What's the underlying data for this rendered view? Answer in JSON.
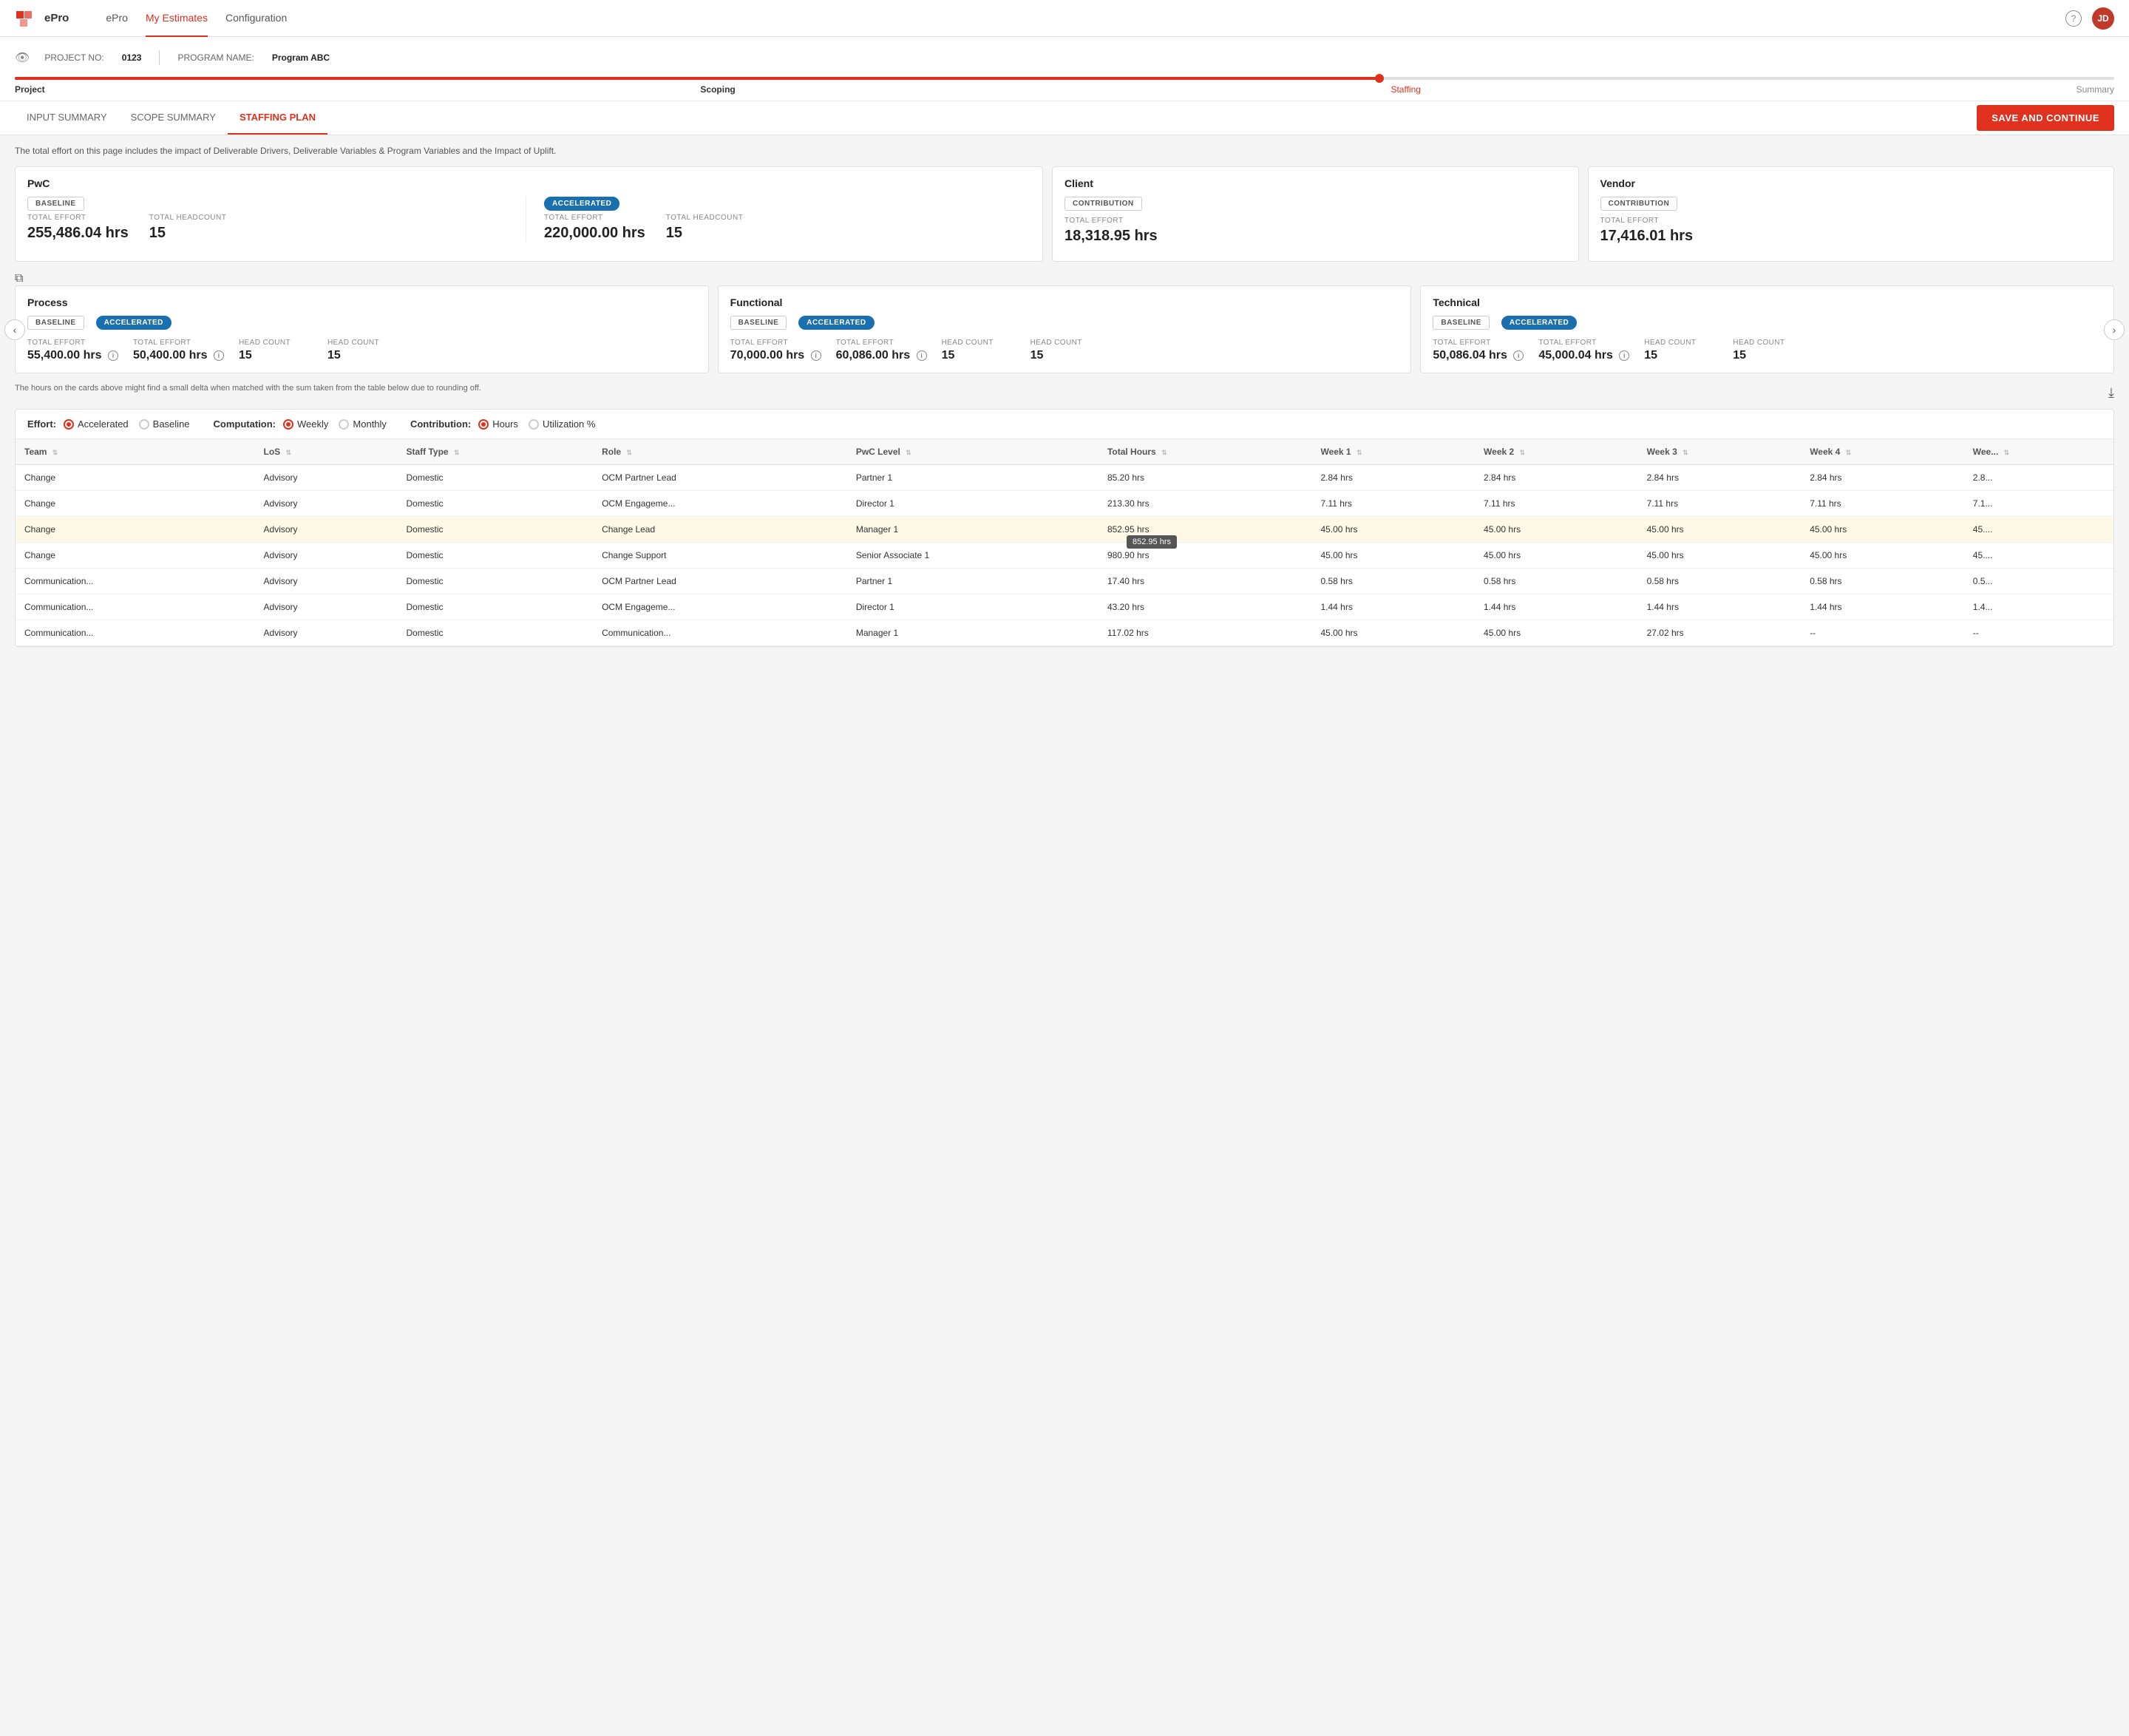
{
  "app": {
    "logo_text": "ePro",
    "nav_links": [
      "ePro",
      "My Estimates",
      "Configuration"
    ],
    "active_nav": "My Estimates",
    "help_icon": "?",
    "user_initials": "JD"
  },
  "project_header": {
    "project_no_label": "PROJECT NO:",
    "project_no": "0123",
    "program_name_label": "PROGRAM NAME:",
    "program_name": "Program ABC"
  },
  "progress": {
    "steps": [
      "Project",
      "Scoping",
      "Staffing",
      "Summary"
    ],
    "active_step": "Staffing"
  },
  "tabs": {
    "items": [
      "INPUT SUMMARY",
      "SCOPE SUMMARY",
      "STAFFING PLAN"
    ],
    "active": "STAFFING PLAN"
  },
  "save_button_label": "SAVE AND CONTINUE",
  "info_text": "The total effort on this page includes the impact of Deliverable Drivers, Deliverable Variables & Program Variables and the Impact of Uplift.",
  "pwc_card": {
    "title": "PwC",
    "baseline_label": "BASELINE",
    "accelerated_label": "ACCELERATED",
    "baseline_total_effort_label": "TOTAL EFFORT",
    "baseline_total_effort": "255,486.04 hrs",
    "baseline_headcount_label": "TOTAL HEADCOUNT",
    "baseline_headcount": "15",
    "acc_total_effort_label": "TOTAL EFFORT",
    "acc_total_effort": "220,000.00 hrs",
    "acc_headcount_label": "TOTAL HEADCOUNT",
    "acc_headcount": "15"
  },
  "client_card": {
    "title": "Client",
    "contribution_label": "CONTRIBUTION",
    "total_effort_label": "TOTAL EFFORT",
    "total_effort": "18,318.95 hrs"
  },
  "vendor_card": {
    "title": "Vendor",
    "contribution_label": "CONTRIBUTION",
    "total_effort_label": "TOTAL EFFORT",
    "total_effort": "17,416.01 hrs"
  },
  "category_cards": [
    {
      "title": "Process",
      "baseline_label": "BASELINE",
      "accelerated_label": "ACCELERATED",
      "baseline_effort_label": "TOTAL EFFORT",
      "baseline_effort": "55,400.00 hrs",
      "acc_effort_label": "TOTAL EFFORT",
      "acc_effort": "50,400.00 hrs",
      "baseline_headcount_label": "HEAD COUNT",
      "baseline_headcount": "15",
      "acc_headcount_label": "HEAD COUNT",
      "acc_headcount": "15"
    },
    {
      "title": "Functional",
      "baseline_label": "BASELINE",
      "accelerated_label": "ACCELERATED",
      "baseline_effort_label": "TOTAL EFFORT",
      "baseline_effort": "70,000.00 hrs",
      "acc_effort_label": "TOTAL EFFORT",
      "acc_effort": "60,086.00 hrs",
      "baseline_headcount_label": "HEAD COUNT",
      "baseline_headcount": "15",
      "acc_headcount_label": "HEAD COUNT",
      "acc_headcount": "15"
    },
    {
      "title": "Technical",
      "baseline_label": "BASELINE",
      "accelerated_label": "ACCELERATED",
      "baseline_effort_label": "TOTAL EFFORT",
      "baseline_effort": "50,086.04 hrs",
      "acc_effort_label": "TOTAL EFFORT",
      "acc_effort": "45,000.04 hrs",
      "baseline_headcount_label": "HEAD COUNT",
      "baseline_headcount": "15",
      "acc_headcount_label": "HEAD COUNT",
      "acc_headcount": "15"
    }
  ],
  "delta_note": "The hours on the cards above might find a small delta when matched with the sum taken from the table below due to rounding off.",
  "table_controls": {
    "effort_label": "Effort:",
    "effort_options": [
      "Accelerated",
      "Baseline"
    ],
    "effort_active": "Accelerated",
    "computation_label": "Computation:",
    "computation_options": [
      "Weekly",
      "Monthly"
    ],
    "computation_active": "Weekly",
    "contribution_label": "Contribution:",
    "contribution_options": [
      "Hours",
      "Utilization %"
    ],
    "contribution_active": "Hours"
  },
  "table": {
    "columns": [
      "Team",
      "LoS",
      "Staff Type",
      "Role",
      "PwC Level",
      "Total Hours",
      "Week 1",
      "Week 2",
      "Week 3",
      "Week 4",
      "Wee..."
    ],
    "rows": [
      {
        "team": "Change",
        "los": "Advisory",
        "staff_type": "Domestic",
        "role": "OCM Partner Lead",
        "pwc_level": "Partner 1",
        "total_hours": "85.20 hrs",
        "week1": "2.84 hrs",
        "week2": "2.84 hrs",
        "week3": "2.84 hrs",
        "week4": "2.84 hrs",
        "week5": "2.8...",
        "highlighted": false
      },
      {
        "team": "Change",
        "los": "Advisory",
        "staff_type": "Domestic",
        "role": "OCM Engageme...",
        "pwc_level": "Director 1",
        "total_hours": "213.30 hrs",
        "week1": "7.11 hrs",
        "week2": "7.11 hrs",
        "week3": "7.11 hrs",
        "week4": "7.11 hrs",
        "week5": "7.1...",
        "highlighted": false
      },
      {
        "team": "Change",
        "los": "Advisory",
        "staff_type": "Domestic",
        "role": "Change Lead",
        "pwc_level": "Manager 1",
        "total_hours": "852.95 hrs",
        "week1": "45.00 hrs",
        "week2": "45.00 hrs",
        "week3": "45.00 hrs",
        "week4": "45.00 hrs",
        "week5": "45....",
        "highlighted": true,
        "tooltip": "852.95 hrs"
      },
      {
        "team": "Change",
        "los": "Advisory",
        "staff_type": "Domestic",
        "role": "Change Support",
        "pwc_level": "Senior Associate 1",
        "total_hours": "980.90 hrs",
        "week1": "45.00 hrs",
        "week2": "45.00 hrs",
        "week3": "45.00 hrs",
        "week4": "45.00 hrs",
        "week5": "45....",
        "highlighted": false
      },
      {
        "team": "Communication...",
        "los": "Advisory",
        "staff_type": "Domestic",
        "role": "OCM Partner Lead",
        "pwc_level": "Partner 1",
        "total_hours": "17.40 hrs",
        "week1": "0.58 hrs",
        "week2": "0.58 hrs",
        "week3": "0.58 hrs",
        "week4": "0.58 hrs",
        "week5": "0.5...",
        "highlighted": false
      },
      {
        "team": "Communication...",
        "los": "Advisory",
        "staff_type": "Domestic",
        "role": "OCM Engageme...",
        "pwc_level": "Director 1",
        "total_hours": "43.20 hrs",
        "week1": "1.44 hrs",
        "week2": "1.44 hrs",
        "week3": "1.44 hrs",
        "week4": "1.44 hrs",
        "week5": "1.4...",
        "highlighted": false
      },
      {
        "team": "Communication...",
        "los": "Advisory",
        "staff_type": "Domestic",
        "role": "Communication...",
        "pwc_level": "Manager 1",
        "total_hours": "117.02 hrs",
        "week1": "45.00 hrs",
        "week2": "45.00 hrs",
        "week3": "27.02 hrs",
        "week4": "--",
        "week5": "--",
        "highlighted": false
      }
    ]
  }
}
